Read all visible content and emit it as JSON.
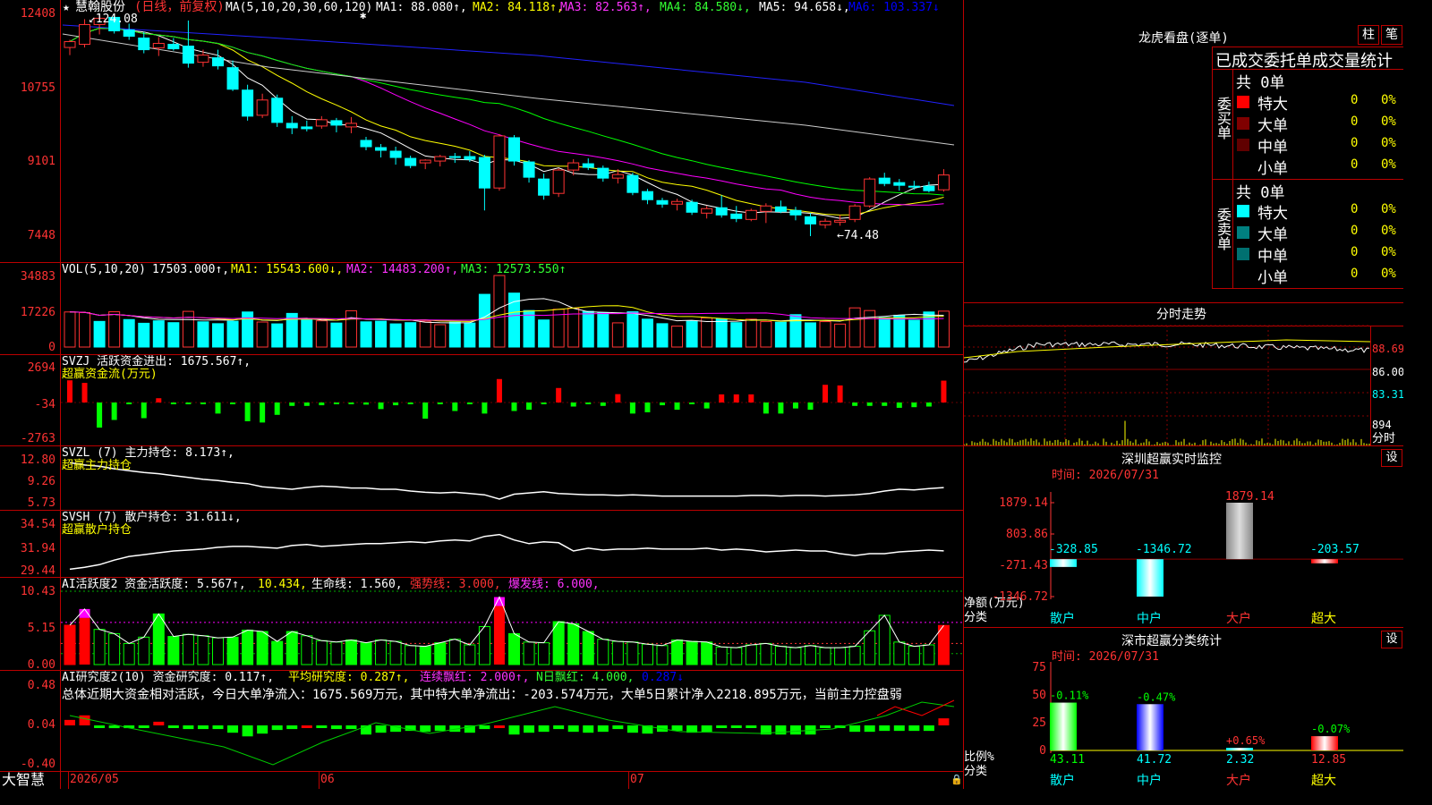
{
  "header": {
    "star": "★",
    "stock_name": "慧翰股份",
    "period": "(日线，前复权)",
    "ma_label": "MA(5,10,20,30,60,120)",
    "ma1": "MA1: 88.080↑,",
    "ma2": "MA2: 84.118↑,",
    "ma3": "MA3: 82.563↑,",
    "ma4": "MA4: 84.580↓,",
    "ma5": "MA5: 94.658↓,",
    "ma6": "MA6: 103.337↓"
  },
  "price_axis": [
    "12408",
    "10755",
    "9101",
    "7448"
  ],
  "price_marks": {
    "high": "124.08",
    "low": "←74.48"
  },
  "vol": {
    "label": "VOL(5,10,20)",
    "value": "17503.000↑,",
    "ma1": "MA1: 15543.600↓,",
    "ma2": "MA2: 14483.200↑,",
    "ma3": "MA3: 12573.550↑",
    "axis": [
      "34883",
      "17226",
      "0"
    ]
  },
  "svzj": {
    "label": "SVZJ  活跃资金进出: 1675.567↑,",
    "sub": "超赢资金流(万元)",
    "axis": [
      "2694",
      "-34",
      "-2763"
    ]
  },
  "svzl": {
    "label": "SVZL (7) 主力持仓: 8.173↑,",
    "sub": "超赢主力持仓",
    "axis": [
      "12.80",
      "9.26",
      "5.73"
    ]
  },
  "svsh": {
    "label": "SVSH (7) 散户持仓: 31.611↓,",
    "sub": "超赢散户持仓",
    "axis": [
      "34.54",
      "31.94",
      "29.44"
    ]
  },
  "ai1": {
    "label_a": "AI活跃度2 资金活跃度: 5.567↑,",
    "label_b": "10.434,",
    "label_c": "生命线: 1.560,",
    "label_d": "强势线: 3.000,",
    "label_e": "爆发线: 6.000,",
    "axis": [
      "10.43",
      "5.15",
      "0.00"
    ]
  },
  "ai2": {
    "label_a": "AI研究度2(10) 资金研究度: 0.117↑,",
    "label_b": "平均研究度: 0.287↑,",
    "label_c": "连续飘红: 2.000↑,",
    "label_d": "N日飘红: 4.000,",
    "label_e": "0.287↓",
    "summary": "总体近期大资金相对活跃，今日大单净流入：1675.569万元，其中特大单净流出：-203.574万元，大单5日累计净入2218.895万元，当前主力控盘弱",
    "axis": [
      "0.48",
      "0.04",
      "-0.40"
    ]
  },
  "bottom": {
    "brand": "大智慧",
    "dates": [
      "2026/05",
      "06",
      "07"
    ]
  },
  "right": {
    "dragon_title": "龙虎看盘(逐单)",
    "btn_zhu": "柱",
    "btn_bi": "笔",
    "tabs": "已成交委托单成交量统计",
    "buy_side": "委买单",
    "sell_side": "委卖单",
    "buy_total": "共 0单",
    "sell_total": "共 0单",
    "buy_rows": [
      {
        "name": "特大",
        "count": "0",
        "pct": "0%",
        "color": "#ff0000"
      },
      {
        "name": "大单",
        "count": "0",
        "pct": "0%",
        "color": "#800000"
      },
      {
        "name": "中单",
        "count": "0",
        "pct": "0%",
        "color": "#600000"
      },
      {
        "name": "小单",
        "count": "0",
        "pct": "0%",
        "color": "#000000"
      }
    ],
    "sell_rows": [
      {
        "name": "特大",
        "count": "0",
        "pct": "0%",
        "color": "#00ffff"
      },
      {
        "name": "大单",
        "count": "0",
        "pct": "0%",
        "color": "#008080"
      },
      {
        "name": "中单",
        "count": "0",
        "pct": "0%",
        "color": "#007070"
      },
      {
        "name": "小单",
        "count": "0",
        "pct": "0%",
        "color": "#000000"
      }
    ],
    "fenshi_title": "分时走势",
    "fenshi_axis": [
      "88.69",
      "86.00",
      "83.31",
      "894",
      "分时"
    ],
    "sz_title": "深圳超赢实时监控",
    "sz_btn": "设",
    "sz_time": "时间: 2026/07/31",
    "sz_axis": [
      "1879.14",
      "803.86",
      "-271.43",
      "-1346.72"
    ],
    "sz_ylabel": "净额(万元)",
    "sz_xlabel": "分类",
    "sz_cats": [
      "散户",
      "中户",
      "大户",
      "超大"
    ],
    "sz_vals": [
      "-328.85",
      "-1346.72",
      "1879.14",
      "-203.57"
    ],
    "ss_title": "深市超赢分类统计",
    "ss_btn": "设",
    "ss_time": "时间: 2026/07/31",
    "ss_axis": [
      "75",
      "50",
      "25",
      "0"
    ],
    "ss_ylabel": "比例%",
    "ss_xlabel": "分类",
    "ss_cats": [
      "散户",
      "中户",
      "大户",
      "超大"
    ],
    "ss_chg": [
      "-0.11%",
      "-0.47%",
      "+0.65%",
      "-0.07%"
    ],
    "ss_vals": [
      "43.11",
      "41.72",
      "2.32",
      "12.85"
    ]
  },
  "chart_data": [
    {
      "type": "candlestick",
      "title": "慧翰股份(日线，前复权)",
      "x_labels": [
        "2026/05",
        "06",
        "07"
      ],
      "ylim": [
        74.48,
        124.08
      ],
      "note": "daily OHLC, approx 60 bars",
      "ohlc": [
        [
          116.5,
          118.2,
          114.8,
          117.8
        ],
        [
          117.2,
          122.8,
          116.5,
          121.6
        ],
        [
          121.6,
          124.08,
          119.4,
          123.0
        ],
        [
          123.2,
          124.0,
          119.6,
          120.2
        ],
        [
          120.4,
          121.8,
          118.2,
          119.0
        ],
        [
          118.6,
          120.0,
          115.2,
          116.0
        ],
        [
          116.4,
          118.8,
          114.6,
          117.4
        ],
        [
          117.2,
          118.6,
          115.8,
          116.2
        ],
        [
          116.8,
          122.5,
          112.0,
          113.0
        ],
        [
          113.2,
          116.0,
          112.2,
          114.8
        ],
        [
          114.2,
          116.0,
          111.6,
          112.4
        ],
        [
          112.0,
          113.6,
          106.8,
          107.2
        ],
        [
          107.0,
          108.2,
          100.2,
          101.2
        ],
        [
          101.4,
          106.2,
          100.8,
          104.8
        ],
        [
          105.2,
          106.0,
          98.8,
          99.8
        ],
        [
          99.6,
          101.2,
          97.2,
          98.6
        ],
        [
          98.8,
          100.2,
          97.8,
          98.4
        ],
        [
          99.0,
          101.2,
          98.4,
          100.4
        ],
        [
          100.2,
          100.8,
          97.6,
          99.2
        ],
        [
          98.8,
          101.0,
          97.4,
          99.6
        ],
        [
          95.8,
          96.6,
          93.6,
          94.4
        ],
        [
          94.2,
          95.0,
          92.0,
          93.6
        ],
        [
          93.4,
          94.4,
          90.4,
          92.0
        ],
        [
          91.8,
          92.4,
          89.6,
          90.2
        ],
        [
          90.8,
          91.6,
          89.4,
          91.4
        ],
        [
          91.2,
          92.6,
          90.0,
          92.2
        ],
        [
          92.2,
          93.0,
          90.8,
          92.0
        ],
        [
          92.2,
          93.4,
          91.0,
          91.6
        ],
        [
          92.0,
          92.6,
          80.2,
          85.2
        ],
        [
          85.2,
          97.2,
          84.6,
          96.8
        ],
        [
          96.4,
          97.0,
          90.2,
          91.2
        ],
        [
          91.0,
          91.4,
          86.4,
          87.6
        ],
        [
          87.2,
          88.4,
          82.6,
          83.6
        ],
        [
          84.0,
          89.6,
          83.2,
          89.2
        ],
        [
          89.2,
          91.6,
          88.0,
          90.8
        ],
        [
          90.6,
          91.8,
          89.2,
          89.8
        ],
        [
          89.6,
          90.2,
          86.6,
          87.4
        ],
        [
          87.4,
          89.4,
          86.2,
          88.2
        ],
        [
          88.0,
          88.6,
          83.6,
          84.2
        ],
        [
          84.4,
          85.0,
          81.6,
          82.6
        ],
        [
          82.4,
          83.0,
          80.8,
          81.6
        ],
        [
          81.6,
          82.8,
          80.2,
          82.2
        ],
        [
          82.0,
          82.6,
          79.2,
          79.8
        ],
        [
          79.6,
          81.2,
          78.4,
          80.6
        ],
        [
          80.8,
          83.6,
          78.6,
          79.2
        ],
        [
          79.4,
          81.2,
          77.6,
          78.4
        ],
        [
          78.2,
          80.6,
          77.8,
          80.2
        ],
        [
          80.0,
          81.8,
          77.4,
          81.2
        ],
        [
          81.0,
          82.4,
          79.6,
          80.0
        ],
        [
          80.2,
          81.0,
          78.0,
          79.2
        ],
        [
          78.8,
          79.6,
          74.48,
          77.2
        ],
        [
          77.0,
          78.4,
          76.2,
          77.8
        ],
        [
          77.6,
          79.2,
          76.8,
          78.0
        ],
        [
          78.2,
          81.6,
          77.6,
          81.2
        ],
        [
          81.2,
          87.6,
          80.8,
          87.2
        ],
        [
          87.4,
          88.6,
          85.6,
          86.2
        ],
        [
          86.4,
          87.2,
          84.6,
          85.8
        ],
        [
          85.6,
          86.8,
          84.8,
          85.4
        ],
        [
          85.6,
          86.6,
          84.2,
          84.6
        ],
        [
          84.8,
          89.4,
          84.4,
          88.1
        ]
      ]
    },
    {
      "type": "bar",
      "title": "VOL(5,10,20)",
      "ylim": [
        0,
        34883
      ],
      "values": [
        17100,
        16800,
        12500,
        17200,
        13400,
        11600,
        12800,
        11900,
        17400,
        12300,
        11400,
        12600,
        17100,
        12200,
        11300,
        16400,
        13200,
        12800,
        11700,
        17700,
        12300,
        12600,
        11300,
        11900,
        12600,
        10900,
        12100,
        11700,
        25700,
        34883,
        26300,
        17800,
        13200,
        18400,
        19000,
        17400,
        16800,
        11800,
        17200,
        13600,
        11400,
        10200,
        12800,
        14200,
        13800,
        11900,
        13600,
        12400,
        12100,
        15800,
        11800,
        12400,
        11200,
        19100,
        17800,
        14300,
        15500,
        13100,
        17100,
        17503
      ],
      "up": [
        1,
        1,
        0,
        1,
        0,
        0,
        0,
        0,
        1,
        0,
        0,
        0,
        0,
        1,
        0,
        0,
        0,
        1,
        0,
        1,
        0,
        0,
        0,
        0,
        1,
        1,
        0,
        0,
        0,
        1,
        0,
        0,
        0,
        1,
        1,
        0,
        0,
        1,
        0,
        0,
        0,
        1,
        0,
        1,
        0,
        0,
        1,
        1,
        0,
        0,
        0,
        1,
        1,
        1,
        1,
        0,
        0,
        0,
        0,
        1
      ]
    },
    {
      "type": "bar",
      "title": "超赢资金流(万元)",
      "ylim": [
        -2763,
        2694
      ],
      "values": [
        1700,
        1500,
        -2000,
        -1400,
        -120,
        -1260,
        300,
        -100,
        -150,
        -120,
        -900,
        -80,
        -1500,
        -1600,
        -1000,
        -300,
        -300,
        -250,
        -120,
        -150,
        -200,
        -550,
        -250,
        -100,
        -1300,
        -100,
        -700,
        -150,
        -900,
        1800,
        -700,
        -600,
        -100,
        1100,
        -350,
        -150,
        -300,
        620,
        -900,
        -800,
        -250,
        -600,
        -120,
        -500,
        600,
        600,
        600,
        -900,
        -900,
        -500,
        -600,
        1350,
        1300,
        -300,
        -300,
        -300,
        -450,
        -400,
        -350,
        1675.567
      ]
    },
    {
      "type": "line",
      "title": "超赢主力持仓",
      "ylim": [
        5.73,
        12.8
      ],
      "values": [
        12.2,
        11.8,
        11.6,
        11.2,
        10.9,
        10.6,
        10.4,
        10.1,
        9.8,
        9.5,
        9.3,
        9.0,
        8.8,
        8.3,
        8.1,
        7.9,
        8.2,
        8.4,
        8.3,
        8.1,
        8.1,
        7.9,
        7.9,
        7.6,
        7.4,
        7.3,
        7.4,
        7.2,
        7.0,
        6.3,
        7.1,
        7.3,
        7.5,
        7.2,
        7.1,
        7.0,
        7.0,
        6.9,
        7.0,
        6.9,
        6.8,
        6.8,
        6.8,
        6.8,
        6.8,
        6.8,
        6.9,
        6.9,
        6.8,
        6.9,
        6.9,
        6.8,
        6.9,
        7.0,
        7.2,
        7.6,
        7.9,
        7.8,
        8.0,
        8.173
      ]
    },
    {
      "type": "line",
      "title": "超赢散户持仓",
      "ylim": [
        29.44,
        34.54
      ],
      "values": [
        29.6,
        29.8,
        30.1,
        30.6,
        31.0,
        31.2,
        31.4,
        31.6,
        31.7,
        31.8,
        32.0,
        32.1,
        32.1,
        32.0,
        31.9,
        32.2,
        32.3,
        32.1,
        32.2,
        32.3,
        32.4,
        32.4,
        32.5,
        32.6,
        32.5,
        32.7,
        32.8,
        32.7,
        33.2,
        33.4,
        32.8,
        32.4,
        32.6,
        32.5,
        31.6,
        31.9,
        31.7,
        31.8,
        31.8,
        31.9,
        31.8,
        31.8,
        31.8,
        31.9,
        31.7,
        31.8,
        31.7,
        31.5,
        31.6,
        31.7,
        31.6,
        31.6,
        31.3,
        31.1,
        31.3,
        31.3,
        31.5,
        31.6,
        31.7,
        31.611
      ]
    },
    {
      "type": "bar",
      "title": "AI活跃度2 资金活跃度",
      "ylim": [
        0,
        10.43
      ],
      "values": [
        5.6,
        7.9,
        5.0,
        4.4,
        3.0,
        3.9,
        7.2,
        4.0,
        4.3,
        4.1,
        3.8,
        3.9,
        4.9,
        4.7,
        3.3,
        4.7,
        4.1,
        3.4,
        3.2,
        3.5,
        3.1,
        3.5,
        3.3,
        2.7,
        2.6,
        3.1,
        3.6,
        2.8,
        5.4,
        9.6,
        4.4,
        3.2,
        3.1,
        6.1,
        5.8,
        4.7,
        3.6,
        3.3,
        3.2,
        2.9,
        2.7,
        3.5,
        3.3,
        3.2,
        2.5,
        2.4,
        2.8,
        3.0,
        2.6,
        2.4,
        2.7,
        2.4,
        2.4,
        2.6,
        4.8,
        7.0,
        3.2,
        2.6,
        2.8,
        5.567
      ]
    },
    {
      "type": "bar",
      "title": "AI研究度2(10) 资金研究度",
      "ylim": [
        -0.4,
        0.48
      ],
      "values": [
        0.1,
        0.15,
        0.02,
        0.01,
        0.01,
        0.03,
        0.08,
        0.02,
        0.0,
        0.0,
        0.0,
        -0.04,
        -0.08,
        -0.05,
        -0.01,
        0.0,
        0.04,
        0.02,
        0.0,
        0.0,
        -0.06,
        -0.04,
        -0.03,
        -0.02,
        -0.03,
        -0.02,
        -0.03,
        -0.04,
        0.0,
        0.04,
        -0.06,
        -0.04,
        -0.03,
        0.0,
        -0.03,
        -0.04,
        -0.03,
        0.0,
        -0.04,
        -0.05,
        -0.03,
        -0.02,
        -0.04,
        -0.03,
        0.03,
        0.03,
        0.03,
        -0.06,
        -0.06,
        -0.06,
        -0.06,
        0.03,
        0.03,
        -0.03,
        -0.03,
        -0.02,
        -0.02,
        -0.02,
        -0.02,
        0.117
      ]
    },
    {
      "type": "bar",
      "title": "深圳超赢实时监控",
      "xlabel": "分类",
      "ylabel": "净额(万元)",
      "categories": [
        "散户",
        "中户",
        "大户",
        "超大"
      ],
      "values": [
        -328.85,
        -1346.72,
        1879.14,
        -203.57
      ],
      "ylim": [
        -1346.72,
        1879.14
      ]
    },
    {
      "type": "bar",
      "title": "深市超赢分类统计",
      "xlabel": "分类",
      "ylabel": "比例%",
      "categories": [
        "散户",
        "中户",
        "大户",
        "超大"
      ],
      "values": [
        43.11,
        41.72,
        2.32,
        12.85
      ],
      "ylim": [
        0,
        75
      ]
    }
  ]
}
